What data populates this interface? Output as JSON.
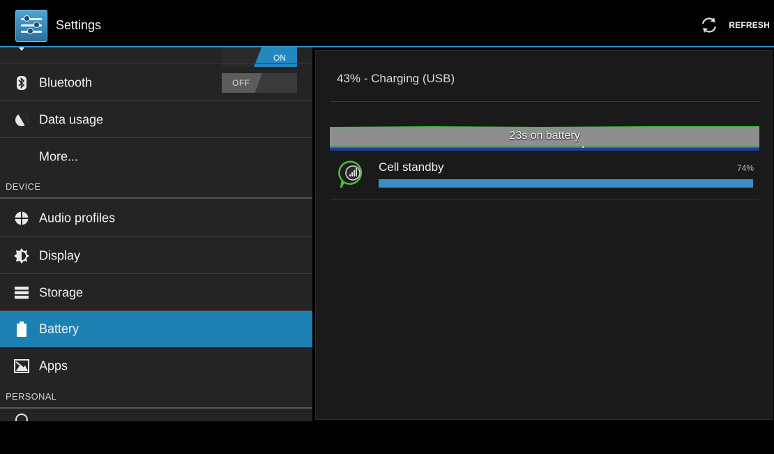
{
  "actionbar": {
    "title": "Settings",
    "refresh_label": "REFRESH"
  },
  "sidebar": {
    "wifi_toggle": "ON",
    "bluetooth": {
      "label": "Bluetooth",
      "toggle": "OFF"
    },
    "data_usage": "Data usage",
    "more": "More...",
    "device_header": "DEVICE",
    "audio_profiles": "Audio profiles",
    "display": "Display",
    "storage": "Storage",
    "battery": "Battery",
    "apps": "Apps",
    "personal_header": "PERSONAL"
  },
  "battery": {
    "status": "43% - Charging (USB)",
    "graph_label": "23s on battery",
    "usage": [
      {
        "name": "Cell standby",
        "percent": "74%",
        "fraction": 1.0
      }
    ]
  },
  "colors": {
    "accent": "#1d80b3",
    "usage_bar": "#3e8cc4",
    "graph_green": "#3fbf3f"
  }
}
